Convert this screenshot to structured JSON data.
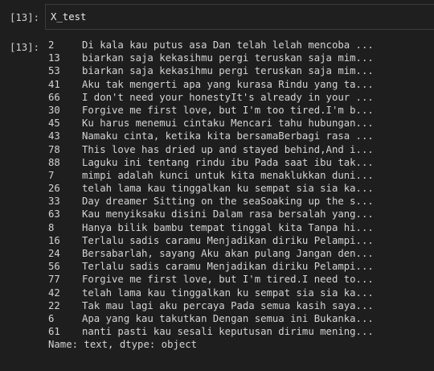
{
  "input_cell": {
    "prompt": "[13]:",
    "code": "X_test"
  },
  "output_cell": {
    "prompt": "[13]:",
    "rows": [
      {
        "index": "2",
        "text": "Di kala kau putus asa Dan telah lelah mencoba ..."
      },
      {
        "index": "13",
        "text": "biarkan saja kekasihmu pergi teruskan saja mim..."
      },
      {
        "index": "53",
        "text": "biarkan saja kekasihmu pergi teruskan saja mim..."
      },
      {
        "index": "41",
        "text": "Aku tak mengerti apa yang kurasa Rindu yang ta..."
      },
      {
        "index": "66",
        "text": "I don't need your honestyIt's already in your ..."
      },
      {
        "index": "30",
        "text": "Forgive me first love, but I'm too tired.I'm b..."
      },
      {
        "index": "45",
        "text": "Ku harus menemui cintaku Mencari tahu hubungan..."
      },
      {
        "index": "43",
        "text": "Namaku cinta, ketika kita bersamaBerbagi rasa ..."
      },
      {
        "index": "78",
        "text": "This love has dried up and stayed behind,And i..."
      },
      {
        "index": "88",
        "text": "Laguku ini tentang rindu ibu Pada saat ibu tak..."
      },
      {
        "index": "7",
        "text": "mimpi adalah kunci untuk kita menaklukkan duni..."
      },
      {
        "index": "26",
        "text": "telah lama kau tinggalkan ku sempat sia sia ka..."
      },
      {
        "index": "33",
        "text": "Day dreamer Sitting on the seaSoaking up the s..."
      },
      {
        "index": "63",
        "text": "Kau menyiksaku disini Dalam rasa bersalah yang..."
      },
      {
        "index": "8",
        "text": "Hanya bilik bambu tempat tinggal kita Tanpa hi..."
      },
      {
        "index": "16",
        "text": "Terlalu sadis caramu Menjadikan diriku Pelampi..."
      },
      {
        "index": "24",
        "text": "Bersabarlah, sayang Aku akan pulang Jangan den..."
      },
      {
        "index": "56",
        "text": "Terlalu sadis caramu Menjadikan diriku Pelampi..."
      },
      {
        "index": "77",
        "text": "Forgive me first love, but I'm tired.I need to..."
      },
      {
        "index": "42",
        "text": "telah lama kau tinggalkan ku sempat sia sia ka..."
      },
      {
        "index": "22",
        "text": "Tak mau lagi aku percaya Pada semua kasih saya..."
      },
      {
        "index": "6",
        "text": "Apa yang kau takutkan Dengan semua ini Bukanka..."
      },
      {
        "index": "61",
        "text": "nanti pasti kau sesali keputusan dirimu mening..."
      }
    ],
    "footer": "Name: text, dtype: object"
  }
}
